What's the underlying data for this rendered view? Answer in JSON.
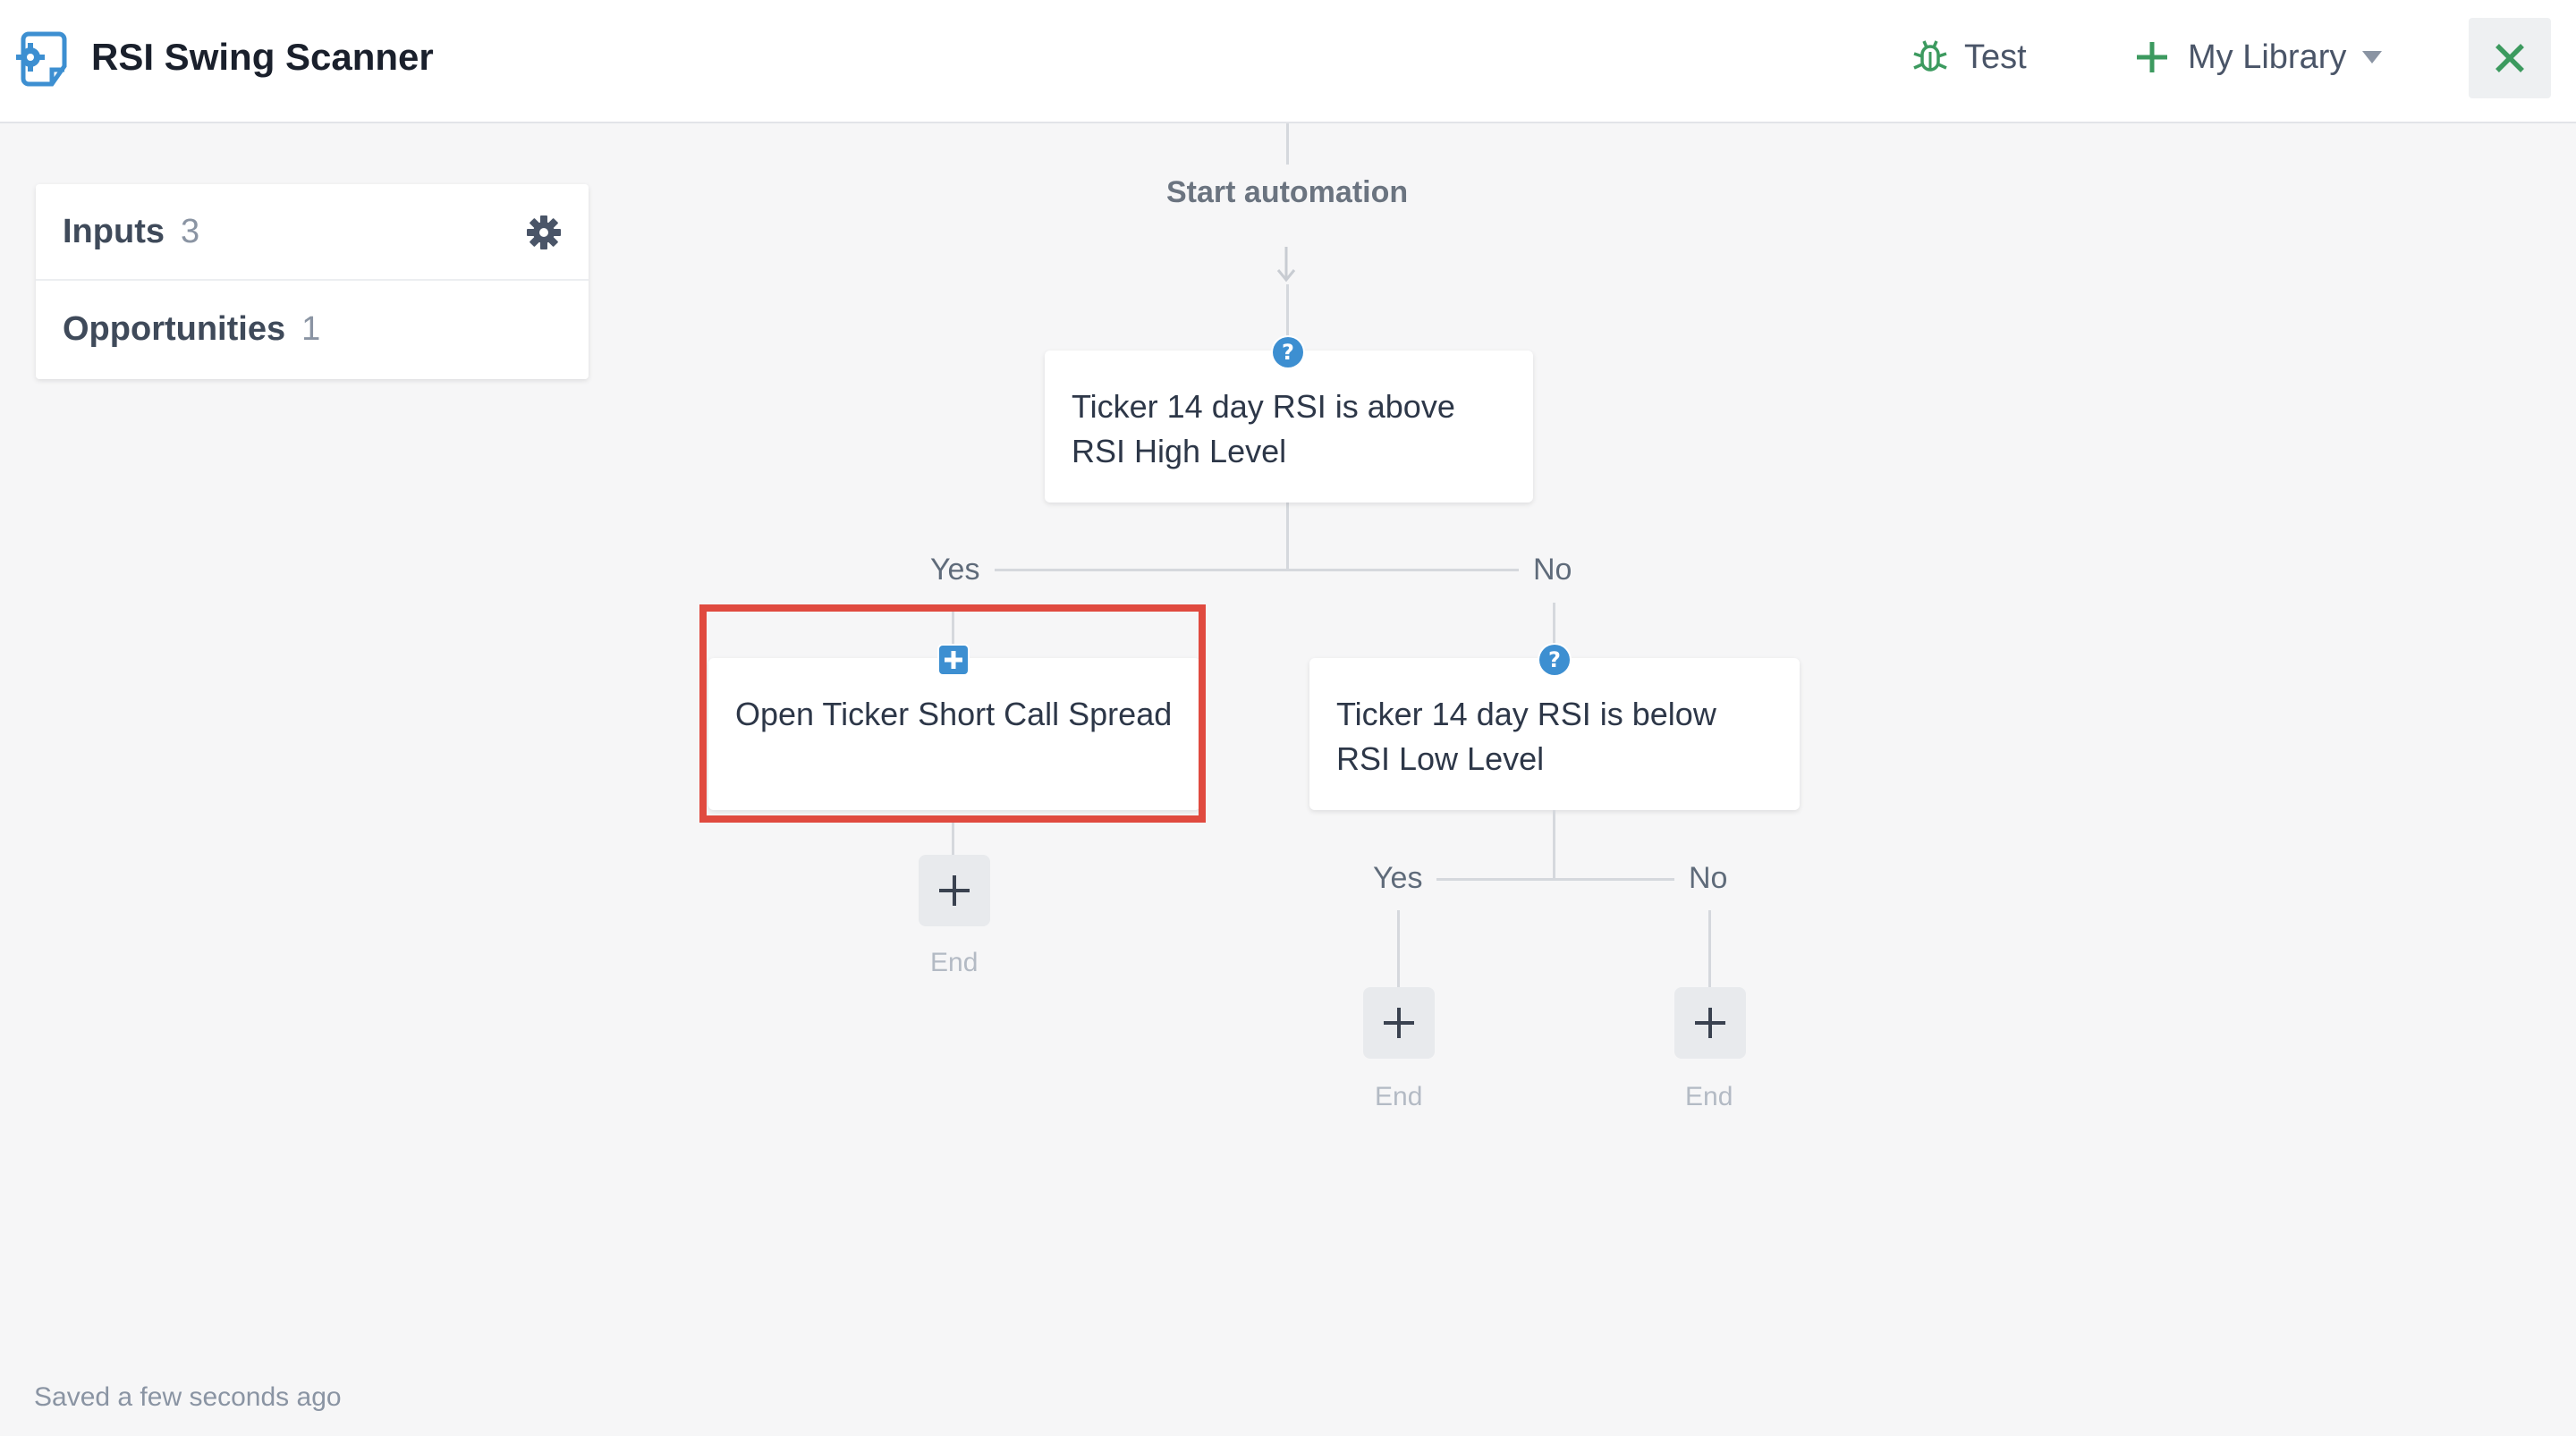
{
  "header": {
    "title": "RSI Swing Scanner",
    "test_label": "Test",
    "library_label": "My Library",
    "icons": {
      "logo": "gear-document-icon",
      "test": "bug-icon",
      "library": "plus-icon",
      "dropdown": "chevron-down-icon",
      "close": "close-icon"
    }
  },
  "sidebar": {
    "items": [
      {
        "label": "Inputs",
        "count": "3"
      },
      {
        "label": "Opportunities",
        "count": "1"
      }
    ],
    "settings_icon": "gear-icon"
  },
  "flow": {
    "start_label": "Start automation",
    "condition_1": "Ticker 14 day RSI is above RSI High Level",
    "yes_1": "Yes",
    "no_1": "No",
    "action_1": "Open Ticker Short Call Spread",
    "condition_2": "Ticker 14 day RSI is below RSI Low Level",
    "yes_2": "Yes",
    "no_2": "No",
    "end_1": "End",
    "end_2": "End",
    "end_3": "End"
  },
  "status": {
    "saved_text": "Saved a few seconds ago"
  },
  "colors": {
    "accent_blue": "#3d8fd1",
    "accent_green": "#3c9a5f",
    "highlight_red": "#e04a3f"
  }
}
